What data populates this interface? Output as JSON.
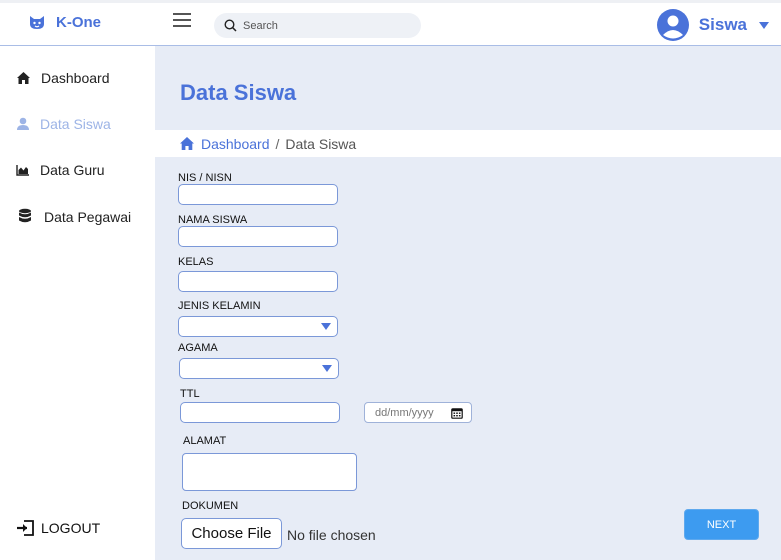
{
  "app": {
    "name": "K-One"
  },
  "header": {
    "search_placeholder": "Search",
    "user_name": "Siswa"
  },
  "sidebar": {
    "items": [
      {
        "label": "Dashboard",
        "icon": "home-icon",
        "active": false
      },
      {
        "label": "Data Siswa",
        "icon": "user-icon",
        "active": true
      },
      {
        "label": "Data Guru",
        "icon": "chart-icon",
        "active": false
      },
      {
        "label": "Data Pegawai",
        "icon": "database-icon",
        "active": false
      }
    ],
    "logout_label": "LOGOUT"
  },
  "main": {
    "title": "Data Siswa",
    "breadcrumb": {
      "home": "Dashboard",
      "separator": "/",
      "current": "Data Siswa"
    },
    "form": {
      "nis_label": "NIS / NISN",
      "nama_label": "NAMA SISWA",
      "kelas_label": "KELAS",
      "jenis_kelamin_label": "JENIS KELAMIN",
      "agama_label": "AGAMA",
      "ttl_label": "TTL",
      "date_placeholder": "dd/mm/yyyy",
      "alamat_label": "ALAMAT",
      "dokumen_label": "DOKUMEN",
      "choose_file_label": "Choose File",
      "file_status": "No file chosen",
      "next_label": "NEXT"
    }
  },
  "colors": {
    "accent": "#4a72d9",
    "active_nav": "#9db4e6",
    "main_bg": "#e7ecf6",
    "button": "#3d9bf0"
  }
}
